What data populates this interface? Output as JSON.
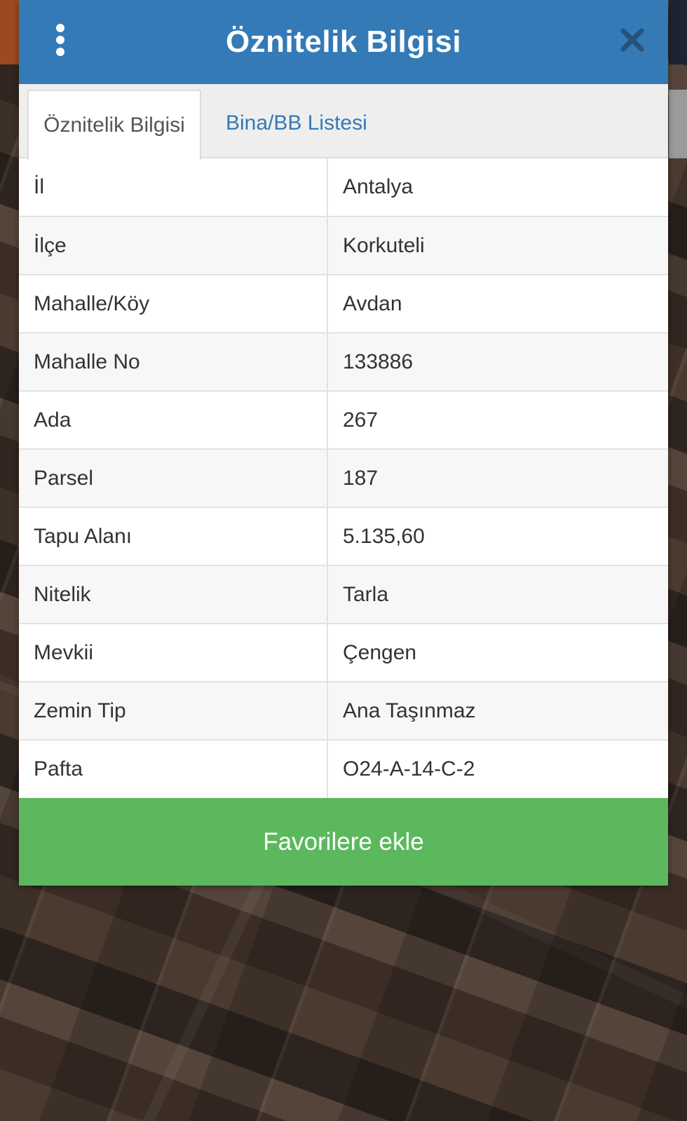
{
  "header": {
    "title": "Öznitelik Bilgisi",
    "menu_icon": "more-vertical-icon",
    "close_icon": "close-icon",
    "color": "#337ab7"
  },
  "tabs": [
    {
      "label": "Öznitelik Bilgisi",
      "active": true
    },
    {
      "label": "Bina/BB Listesi",
      "active": false
    }
  ],
  "attributes": [
    {
      "key": "İl",
      "value": "Antalya"
    },
    {
      "key": "İlçe",
      "value": "Korkuteli"
    },
    {
      "key": "Mahalle/Köy",
      "value": "Avdan"
    },
    {
      "key": "Mahalle No",
      "value": "133886"
    },
    {
      "key": "Ada",
      "value": "267"
    },
    {
      "key": "Parsel",
      "value": "187"
    },
    {
      "key": "Tapu Alanı",
      "value": "5.135,60"
    },
    {
      "key": "Nitelik",
      "value": "Tarla"
    },
    {
      "key": "Mevkii",
      "value": "Çengen"
    },
    {
      "key": "Zemin Tip",
      "value": "Ana Taşınmaz"
    },
    {
      "key": "Pafta",
      "value": "O24-A-14-C-2"
    }
  ],
  "favorite_button": {
    "label": "Favorilere ekle",
    "color": "#5cb85c"
  }
}
